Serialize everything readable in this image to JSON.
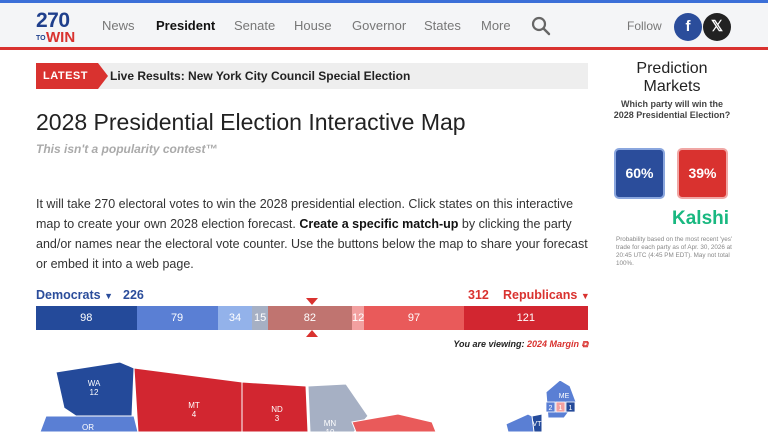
{
  "header": {
    "logo": {
      "top": "270",
      "to": "TO",
      "win": "WIN"
    },
    "nav": [
      "News",
      "President",
      "Senate",
      "House",
      "Governor",
      "States",
      "More"
    ],
    "active_nav": "President",
    "follow": "Follow",
    "facebook": "f",
    "x": "𝕏"
  },
  "latest": {
    "tag": "LATEST",
    "text": "Live Results: New York City Council Special Election"
  },
  "page": {
    "title": "2028 Presidential Election Interactive Map",
    "subtitle": "This isn't a popularity contest™",
    "intro_1": "It will take 270 electoral votes to win the 2028 presidential election. Click states on this interactive map to create your own 2028 election forecast. ",
    "intro_bold": "Create a specific match-up",
    "intro_2": " by clicking the party and/or names near the electoral vote counter. Use the buttons below the map to share your forecast or embed it into a web page."
  },
  "tally": {
    "dem_label": "Democrats",
    "dem_total": "226",
    "rep_label": "Republicans",
    "rep_total": "312",
    "segments": [
      {
        "value": 98,
        "color": "#244a9a"
      },
      {
        "value": 79,
        "color": "#5a7fd4"
      },
      {
        "value": 34,
        "color": "#93b2ea"
      },
      {
        "value": 15,
        "color": "#a6b0c4"
      },
      {
        "value": 82,
        "color": "#c07470"
      },
      {
        "value": 12,
        "color": "#f2a0a0"
      },
      {
        "value": 97,
        "color": "#e95a5a"
      },
      {
        "value": 121,
        "color": "#d22630"
      }
    ],
    "viewing_prefix": "You are viewing:",
    "viewing_link": "2024 Margin"
  },
  "map_labels": [
    {
      "state": "WA",
      "ev": "12"
    },
    {
      "state": "MT",
      "ev": "4"
    },
    {
      "state": "ND",
      "ev": "3"
    },
    {
      "state": "MN",
      "ev": "10"
    },
    {
      "state": "OR",
      "ev": ""
    },
    {
      "state": "ME",
      "ev": ""
    },
    {
      "state": "VT",
      "ev": ""
    }
  ],
  "maine_districts": [
    "2",
    "1",
    "1"
  ],
  "prediction": {
    "title": "Prediction Markets",
    "question": "Which party will win the 2028 Presidential Election?",
    "dem_pct": "60%",
    "rep_pct": "39%",
    "brand": "Kalshi",
    "note": "Probability based on the most recent 'yes' trade for each party as of Apr. 30, 2026 at 20:45 UTC (4:45 PM EDT). May not total 100%."
  }
}
